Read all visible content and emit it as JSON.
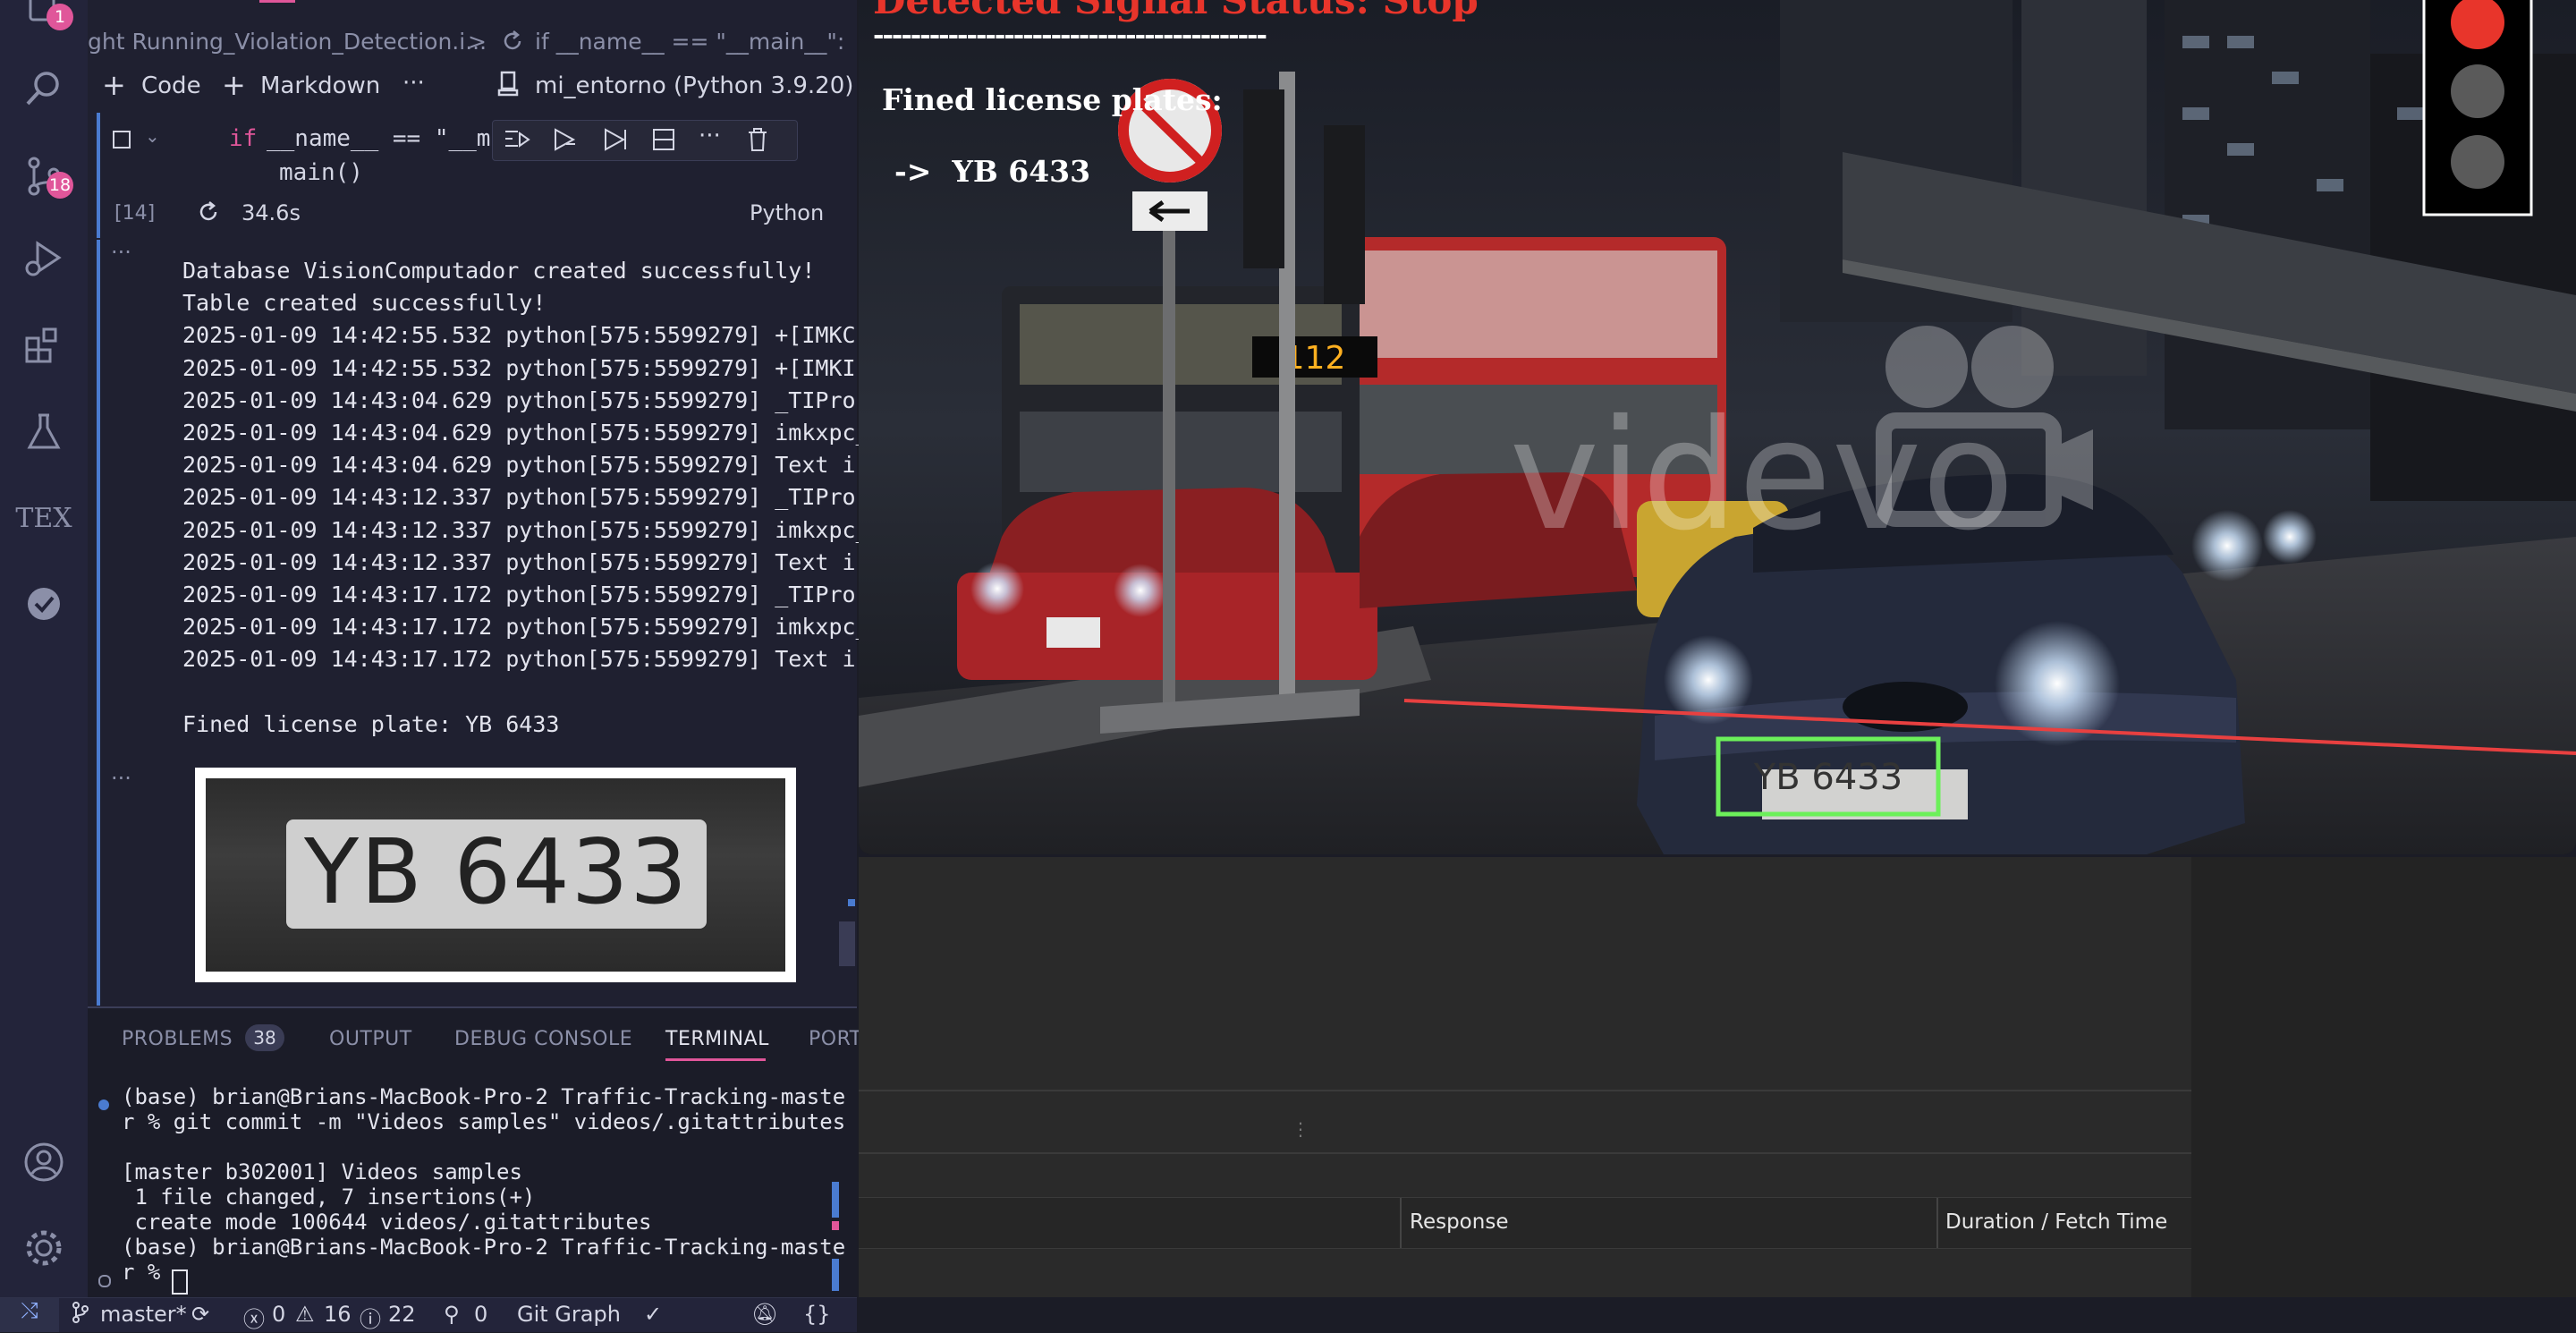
{
  "breadcrumb": {
    "file": "ght Running_Violation_Detection.i...",
    "sep": ">",
    "symbol": "if __name__ == \"__main__\":"
  },
  "toolbar": {
    "code_label": "Code",
    "markdown_label": "Markdown",
    "more_label": "···",
    "kernel_label": "mi_entorno (Python 3.9.20)"
  },
  "activity": {
    "explorer_badge": "1",
    "scm_badge": "18",
    "tex_label": "TEX"
  },
  "cell": {
    "line1_kw": "if",
    "line1_rest": "__name__ == \"__ma",
    "line2": "main()",
    "exec_count": "[14]",
    "duration": "34.6s",
    "language": "Python"
  },
  "output": {
    "more": "···",
    "lines": [
      "Database VisionComputador created successfully!",
      "Table created successfully!",
      "2025-01-09 14:42:55.532 python[575:5599279] +[IMKC",
      "2025-01-09 14:42:55.532 python[575:5599279] +[IMKI",
      "2025-01-09 14:43:04.629 python[575:5599279] _TIPro",
      "2025-01-09 14:43:04.629 python[575:5599279] imkxpc_",
      "2025-01-09 14:43:04.629 python[575:5599279] Text i",
      "2025-01-09 14:43:12.337 python[575:5599279] _TIPro",
      "2025-01-09 14:43:12.337 python[575:5599279] imkxpc_",
      "2025-01-09 14:43:12.337 python[575:5599279] Text i",
      "2025-01-09 14:43:17.172 python[575:5599279] _TIPro",
      "2025-01-09 14:43:17.172 python[575:5599279] imkxpc_",
      "2025-01-09 14:43:17.172 python[575:5599279] Text i",
      "",
      "Fined license plate: YB 6433"
    ],
    "plate_text": "YB 6433"
  },
  "panel": {
    "tabs": [
      "PROBLEMS",
      "OUTPUT",
      "DEBUG CONSOLE",
      "TERMINAL",
      "PORT"
    ],
    "problems_count": "38",
    "terminal": [
      "(base) brian@Brians-MacBook-Pro-2 Traffic-Tracking-maste",
      "r % git commit -m \"Videos samples\" videos/.gitattributes",
      "",
      "[master b302001] Videos samples",
      " 1 file changed, 7 insertions(+)",
      " create mode 100644 videos/.gitattributes",
      "(base) brian@Brians-MacBook-Pro-2 Traffic-Tracking-maste",
      "r % "
    ]
  },
  "statusbar": {
    "branch": "master*",
    "errors": "0",
    "warnings": "16",
    "infos": "22",
    "ports": "0",
    "git_graph": "Git Graph",
    "braces": "{}"
  },
  "video": {
    "status_title": "Detected Signal Status: Stop",
    "dashes": "------------------------------------------",
    "fined_label": "Fined license plates:",
    "plate_entry": "->  YB 6433",
    "detected_plate": "YB 6433",
    "bus_sign": "112",
    "watermark": "videvo"
  },
  "devtools": {
    "col_response": "Response",
    "col_duration": "Duration / Fetch Time"
  },
  "colors": {
    "light_red": "#e8352b",
    "light_off": "#5a5a5a",
    "plate_box": "#6cf05a",
    "violation_line": "#e84040",
    "accent": "#4a7bd0"
  }
}
